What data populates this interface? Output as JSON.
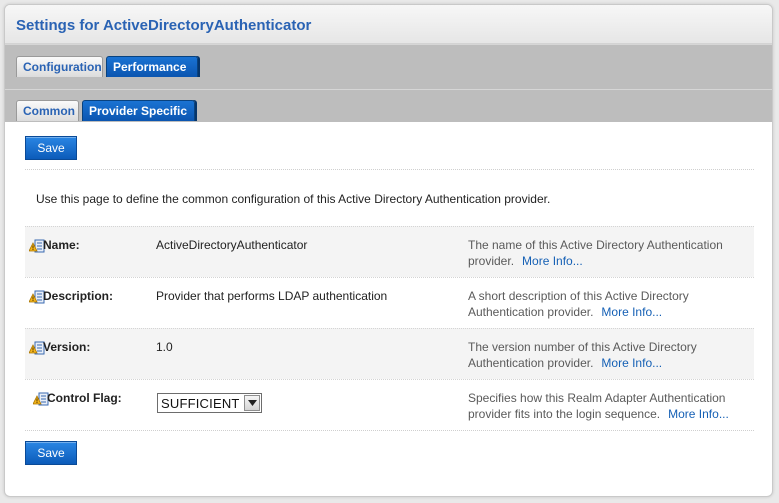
{
  "header": {
    "title": "Settings for ActiveDirectoryAuthenticator"
  },
  "main_tabs": [
    {
      "label": "Configuration",
      "active": false
    },
    {
      "label": "Performance",
      "active": true
    }
  ],
  "sub_tabs": [
    {
      "label": "Common",
      "active": false
    },
    {
      "label": "Provider Specific",
      "active": true
    }
  ],
  "actions": {
    "save_label": "Save"
  },
  "intro": "Use this page to define the common configuration of this Active Directory Authentication provider.",
  "fields": [
    {
      "label": "Name:",
      "value": "ActiveDirectoryAuthenticator",
      "description": "The name of this Active Directory Authentication provider.",
      "more_info": "More Info..."
    },
    {
      "label": "Description:",
      "value": "Provider that performs LDAP authentication",
      "description": "A short description of this Active Directory Authentication provider.",
      "more_info": "More Info..."
    },
    {
      "label": "Version:",
      "value": "1.0",
      "description": "The version number of this Active Directory Authentication provider.",
      "more_info": "More Info..."
    },
    {
      "label": "Control Flag:",
      "value": "SUFFICIENT",
      "description": "Specifies how this Realm Adapter Authentication provider fits into the login sequence.",
      "more_info": "More Info..."
    }
  ],
  "icons": {
    "field_icon": "field-info-icon",
    "dropdown_icon": "chevron-down-icon"
  },
  "colors": {
    "accent": "#2a63b4",
    "tab_active": "#0b55b0",
    "link": "#1560b5"
  }
}
